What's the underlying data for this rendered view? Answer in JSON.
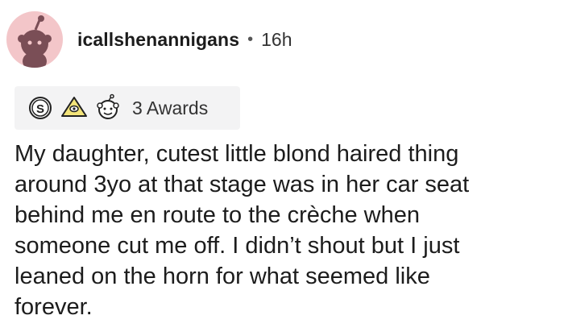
{
  "comment": {
    "username": "icallshenannigans",
    "separator": "•",
    "time": "16h",
    "awards": {
      "count_label": "3 Awards",
      "icons": [
        "silver-award-icon",
        "helpful-award-icon",
        "wholesome-award-icon"
      ]
    },
    "body": "My daughter, cutest little blond haired thing\naround 3yo at that stage was in her car seat\nbehind me en route to the crèche when\nsomeone cut me off. I didn’t shout but I just\nleaned on the horn for what seemed like\nforever."
  },
  "colors": {
    "avatar_bg": "#f3c6c9",
    "awards_bg": "#f3f3f4",
    "text": "#1c1c1c"
  }
}
